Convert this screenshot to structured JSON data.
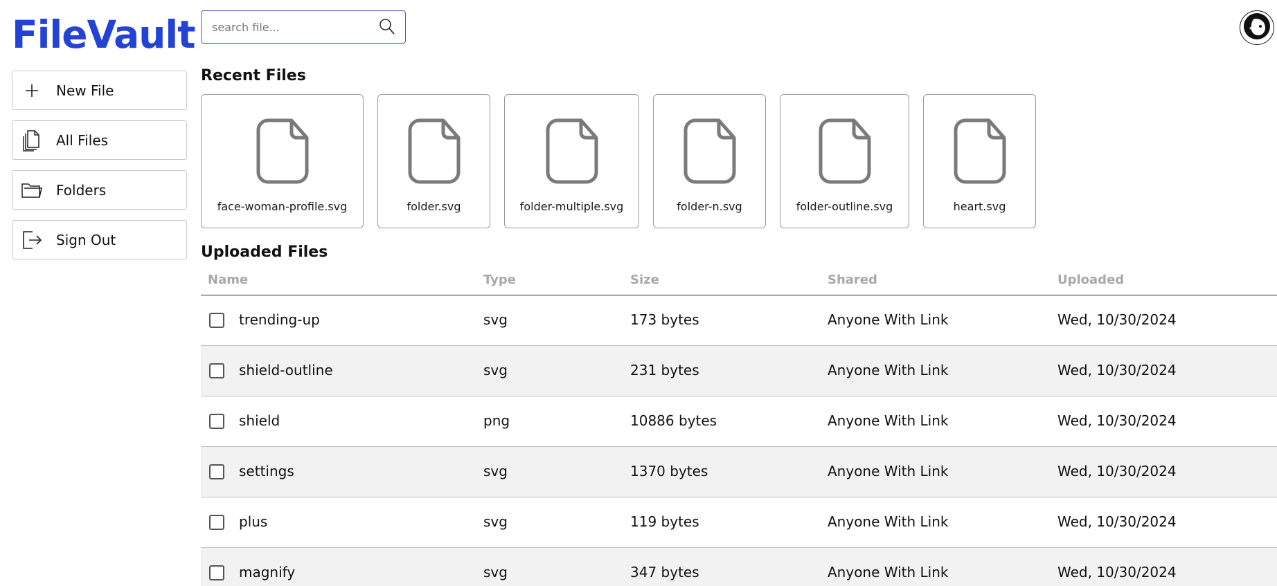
{
  "app": {
    "title": "FileVault",
    "brand_color": "#2443d6"
  },
  "sidebar": {
    "items": [
      {
        "label": "New File",
        "icon": "plus-icon"
      },
      {
        "label": "All Files",
        "icon": "files-icon"
      },
      {
        "label": "Folders",
        "icon": "folder-icon"
      },
      {
        "label": "Sign Out",
        "icon": "logout-icon"
      }
    ]
  },
  "search": {
    "placeholder": "search file...",
    "value": "",
    "icon": "search-icon"
  },
  "user": {
    "icon": "avatar-face-icon"
  },
  "recent": {
    "title": "Recent Files",
    "files": [
      {
        "name": "face-woman-profile.svg"
      },
      {
        "name": "folder.svg"
      },
      {
        "name": "folder-multiple.svg"
      },
      {
        "name": "folder-n.svg"
      },
      {
        "name": "folder-outline.svg"
      },
      {
        "name": "heart.svg"
      }
    ]
  },
  "uploaded": {
    "title": "Uploaded Files",
    "columns": [
      "Name",
      "Type",
      "Size",
      "Shared",
      "Uploaded"
    ],
    "rows": [
      {
        "name": "trending-up",
        "type": "svg",
        "size": "173 bytes",
        "shared": "Anyone With Link",
        "uploaded": "Wed, 10/30/2024",
        "checked": false
      },
      {
        "name": "shield-outline",
        "type": "svg",
        "size": "231 bytes",
        "shared": "Anyone With Link",
        "uploaded": "Wed, 10/30/2024",
        "checked": false
      },
      {
        "name": "shield",
        "type": "png",
        "size": "10886 bytes",
        "shared": "Anyone With Link",
        "uploaded": "Wed, 10/30/2024",
        "checked": false
      },
      {
        "name": "settings",
        "type": "svg",
        "size": "1370 bytes",
        "shared": "Anyone With Link",
        "uploaded": "Wed, 10/30/2024",
        "checked": false
      },
      {
        "name": "plus",
        "type": "svg",
        "size": "119 bytes",
        "shared": "Anyone With Link",
        "uploaded": "Wed, 10/30/2024",
        "checked": false
      },
      {
        "name": "magnify",
        "type": "svg",
        "size": "347 bytes",
        "shared": "Anyone With Link",
        "uploaded": "Wed, 10/30/2024",
        "checked": false
      }
    ]
  }
}
